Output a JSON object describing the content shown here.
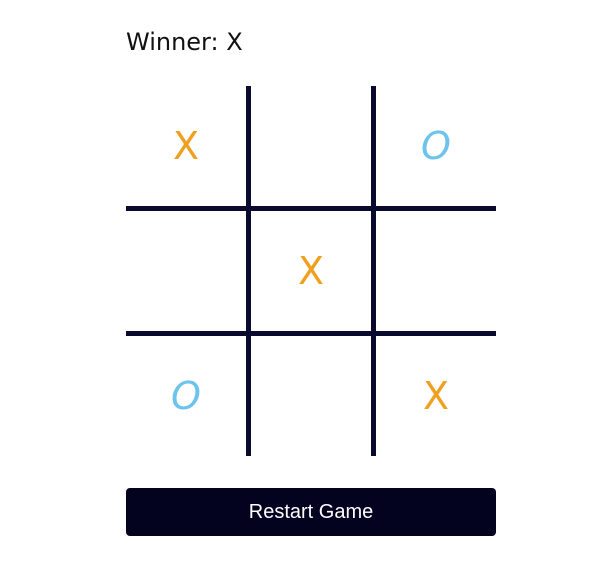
{
  "status": {
    "label": "Winner:",
    "winner": "X"
  },
  "board": {
    "cells": [
      "X",
      "",
      "O",
      "",
      "X",
      "",
      "O",
      "",
      "X"
    ]
  },
  "restart_label": "Restart Game",
  "colors": {
    "x": "#f0a020",
    "o": "#6cc4ec",
    "grid": "#0a0a2e",
    "button": "#03031f"
  }
}
